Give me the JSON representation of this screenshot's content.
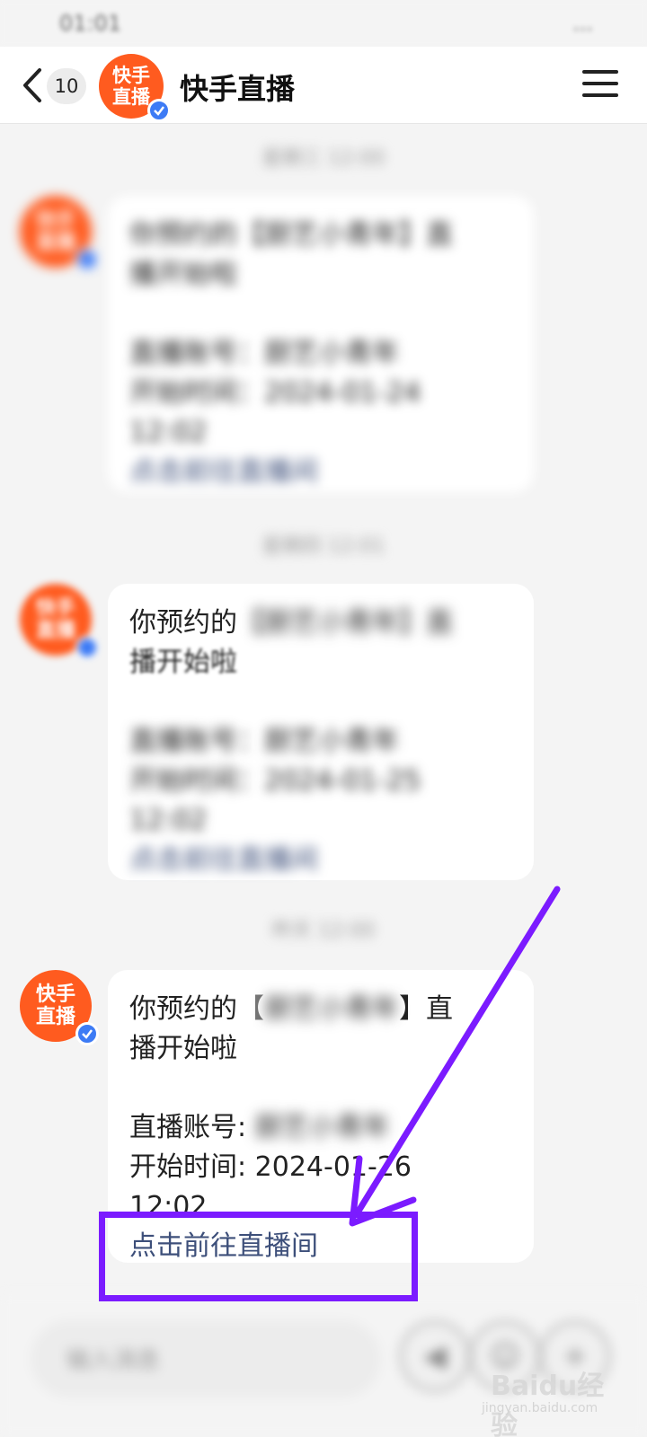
{
  "status_bar": {
    "time": "01:01",
    "icons": "..."
  },
  "nav": {
    "unread_count": "10",
    "avatar_label": "快手直播",
    "title": "快手直播"
  },
  "messages": [
    {
      "timestamp": "星期三 12:00",
      "line1": "你预约的【厨艺小青年】直",
      "line2": "播开始啦",
      "account_label": "直播账号：",
      "account_value": "厨艺小青年",
      "start_label": "开始时间：",
      "start_date": "2024-01-24",
      "start_time": "12:02",
      "link": "点击前往直播间"
    },
    {
      "timestamp": "星期四 12:01",
      "line1_prefix": "你预约的",
      "line1_rest": "【厨艺小青年】直",
      "line2": "播开始啦",
      "account_label": "直播账号：",
      "account_value": "厨艺小青年",
      "start_label": "开始时间：",
      "start_date": "2024-01-25",
      "start_time": "12:02",
      "link": "点击前往直播间"
    },
    {
      "timestamp": "昨天 12:00",
      "line1_prefix": "你预约的",
      "bracket_open": "【",
      "bracket_name": "厨艺小青年",
      "bracket_close": "】直",
      "line2": "播开始啦",
      "account_label": "直播账号:",
      "account_value": "厨艺小青年",
      "start_label": "开始时间:",
      "start_date": "2024-01-26",
      "start_time": "12:02",
      "link": "点击前往直播间"
    }
  ],
  "input_bar": {
    "placeholder": "输入消息"
  },
  "annotation_color": "#7b1bff",
  "brand_color": "#ff5b1f",
  "watermark": {
    "logo": "Baidu经验",
    "sub": "jingyan.baidu.com"
  }
}
